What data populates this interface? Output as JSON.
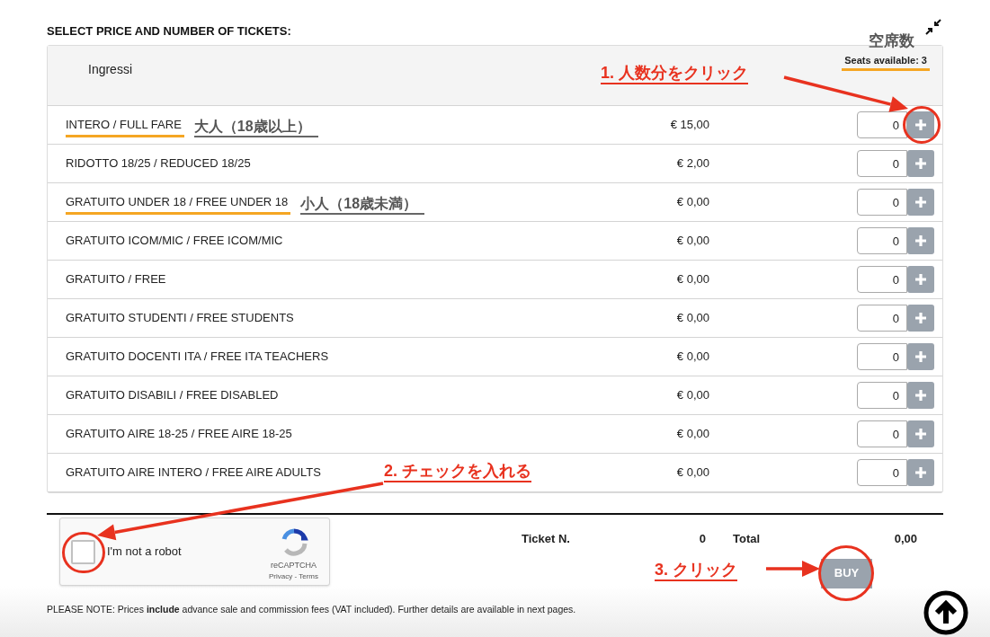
{
  "heading": "SELECT PRICE AND NUMBER OF TICKETS:",
  "panel": {
    "title": "Ingressi",
    "seats": "Seats available: 3",
    "seats_highlighted": true,
    "seats_note": "空席数"
  },
  "rows": [
    {
      "name": "INTERO / FULL FARE",
      "price": "€ 15,00",
      "qty": "0",
      "highlighted": true,
      "note": "大人（18歳以上）",
      "plus_circled": true
    },
    {
      "name": "RIDOTTO 18/25 / REDUCED 18/25",
      "price": "€ 2,00",
      "qty": "0",
      "highlighted": false,
      "plus_circled": false
    },
    {
      "name": "GRATUITO UNDER 18 / FREE UNDER 18",
      "price": "€ 0,00",
      "qty": "0",
      "highlighted": true,
      "note": "小人（18歳未満）",
      "plus_circled": false
    },
    {
      "name": "GRATUITO ICOM/MIC / FREE ICOM/MIC",
      "price": "€ 0,00",
      "qty": "0",
      "highlighted": false,
      "plus_circled": false
    },
    {
      "name": "GRATUITO / FREE",
      "price": "€ 0,00",
      "qty": "0",
      "highlighted": false,
      "plus_circled": false
    },
    {
      "name": "GRATUITO STUDENTI / FREE STUDENTS",
      "price": "€ 0,00",
      "qty": "0",
      "highlighted": false,
      "plus_circled": false
    },
    {
      "name": "GRATUITO DOCENTI ITA / FREE ITA TEACHERS",
      "price": "€ 0,00",
      "qty": "0",
      "highlighted": false,
      "plus_circled": false
    },
    {
      "name": "GRATUITO DISABILI / FREE DISABLED",
      "price": "€ 0,00",
      "qty": "0",
      "highlighted": false,
      "plus_circled": false
    },
    {
      "name": "GRATUITO AIRE 18-25 / FREE AIRE 18-25",
      "price": "€ 0,00",
      "qty": "0",
      "highlighted": false,
      "plus_circled": false
    },
    {
      "name": "GRATUITO AIRE INTERO / FREE AIRE ADULTS",
      "price": "€ 0,00",
      "qty": "0",
      "highlighted": false,
      "plus_circled": false
    }
  ],
  "captcha": {
    "label": "I'm not a robot",
    "checked": false,
    "circled": true,
    "brand": "reCAPTCHA",
    "links": "Privacy - Terms"
  },
  "summary": {
    "tickets_label": "Ticket N.",
    "tickets": "0",
    "total_label": "Total",
    "total": "0,00"
  },
  "buy": {
    "label": "BUY",
    "circled": true
  },
  "note": "PLEASE NOTE: Prices **include** advance sale and commission fees (VAT included). Further details are available in next pages.",
  "annotations": [
    {
      "step": "1.",
      "text": "人数分をクリック"
    },
    {
      "step": "2.",
      "text": "チェックを入れる"
    },
    {
      "step": "3.",
      "text": "クリック"
    }
  ]
}
